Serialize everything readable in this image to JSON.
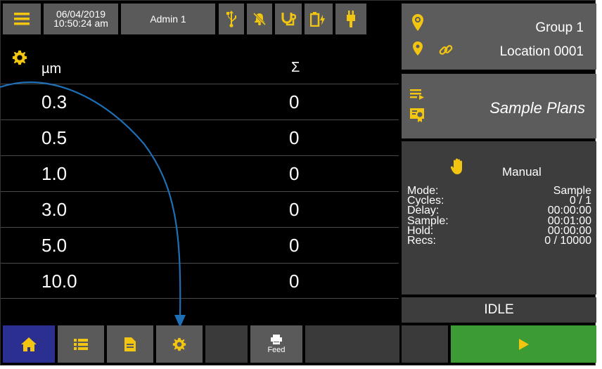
{
  "topbar": {
    "date": "06/04/2019",
    "time": "10:50:24 am",
    "user": "Admin 1"
  },
  "table": {
    "header_size": "µm",
    "header_sum": "Σ",
    "rows": [
      {
        "size": "0.3",
        "count": "0"
      },
      {
        "size": "0.5",
        "count": "0"
      },
      {
        "size": "1.0",
        "count": "0"
      },
      {
        "size": "3.0",
        "count": "0"
      },
      {
        "size": "5.0",
        "count": "0"
      },
      {
        "size": "10.0",
        "count": "0"
      }
    ]
  },
  "location": {
    "group": "Group 1",
    "location": "Location 0001"
  },
  "sample_plans": {
    "label": "Sample Plans"
  },
  "status": {
    "mode_title": "Manual",
    "fields": [
      {
        "label": "Mode:",
        "value": "Sample"
      },
      {
        "label": "Cycles:",
        "value": "0 / 1"
      },
      {
        "label": "Delay:",
        "value": "00:00:00"
      },
      {
        "label": "Sample:",
        "value": "00:01:00"
      },
      {
        "label": "Hold:",
        "value": "00:00:00"
      },
      {
        "label": "Recs:",
        "value": "0 / 10000"
      }
    ],
    "state": "IDLE"
  },
  "bottombar": {
    "feed_label": "Feed"
  },
  "colors": {
    "accent_yellow": "#f2c511",
    "home_active": "#2b2f8f",
    "start_green": "#3d9b35",
    "callout_arrow": "#1e6fb5"
  }
}
